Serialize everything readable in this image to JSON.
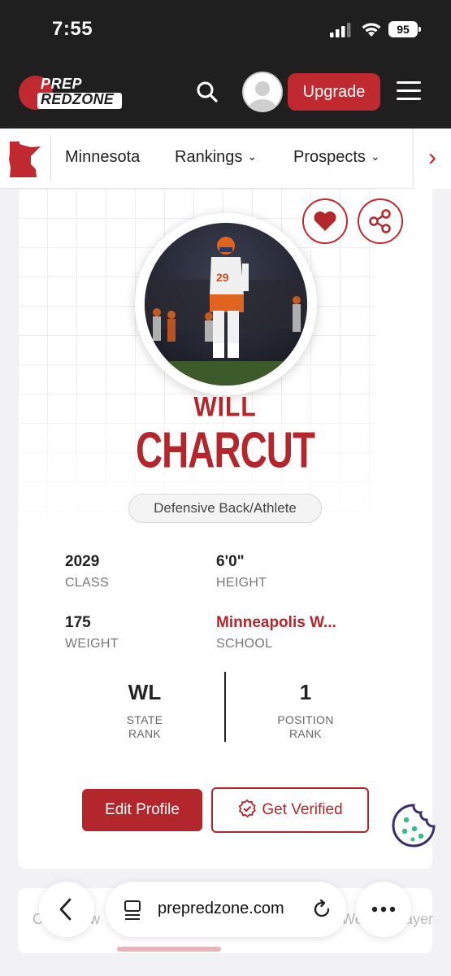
{
  "status_bar": {
    "time": "7:55",
    "battery": "95"
  },
  "header": {
    "logo_line1": "PREP",
    "logo_line2": "REDZONE",
    "upgrade_label": "Upgrade"
  },
  "state_nav": {
    "items": [
      {
        "label": "Minnesota"
      },
      {
        "label": "Rankings"
      },
      {
        "label": "Prospects"
      }
    ]
  },
  "profile": {
    "first_name": "WILL",
    "last_name": "CHARCUT",
    "position": "Defensive Back/Athlete",
    "stats": {
      "class": {
        "value": "2029",
        "label": "CLASS"
      },
      "height": {
        "value": "6'0\"",
        "label": "HEIGHT"
      },
      "weight": {
        "value": "175",
        "label": "WEIGHT"
      },
      "school": {
        "value": "Minneapolis W...",
        "label": "SCHOOL"
      }
    },
    "ranks": {
      "state": {
        "value": "WL",
        "label_line1": "STATE",
        "label_line2": "RANK"
      },
      "position": {
        "value": "1",
        "label_line1": "POSITION",
        "label_line2": "RANK"
      }
    },
    "edit_label": "Edit Profile",
    "verify_label": "Get Verified"
  },
  "lower": {
    "left_fragment": "C",
    "left_fragment2": "w",
    "right_fragment": "We",
    "right_fragment2": "ayer"
  },
  "browser": {
    "url": "prepredzone.com"
  },
  "colors": {
    "brand_red": "#b3262c",
    "header_bg": "#1f1f1f"
  }
}
